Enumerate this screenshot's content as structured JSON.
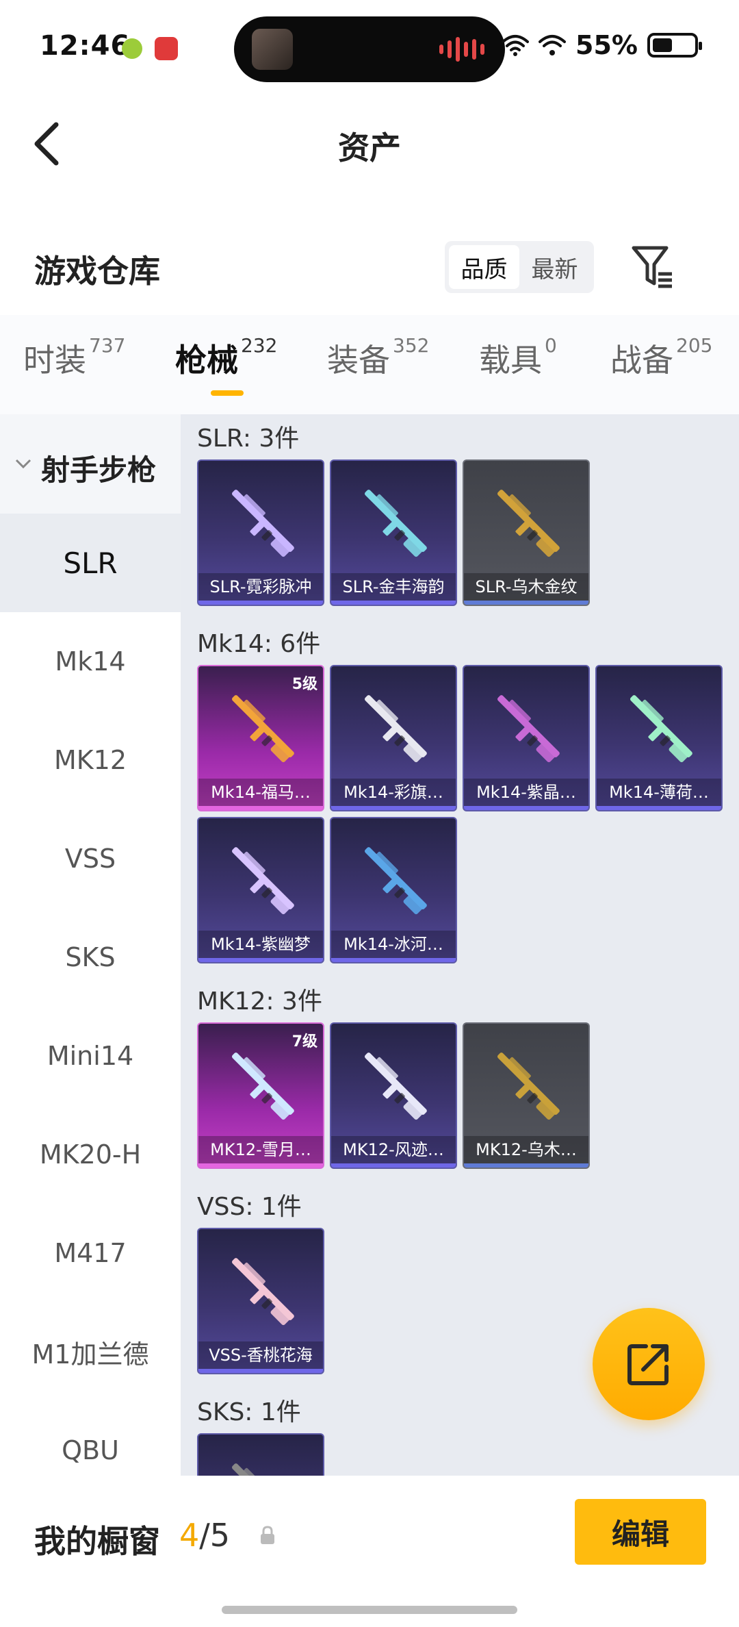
{
  "status_bar": {
    "time": "12:46",
    "battery_percent": "55%",
    "battery_level": 0.55,
    "icons": [
      "app-icon-green",
      "app-icon-red",
      "audio-wave-icon",
      "wifi-icon",
      "signal-icon",
      "battery-icon"
    ]
  },
  "header": {
    "title": "资产",
    "back_icon": "chevron-left-icon"
  },
  "warehouse": {
    "title": "游戏仓库",
    "sort_options": [
      "品质",
      "最新"
    ],
    "selected_sort": "品质",
    "filter_icon": "filter-icon"
  },
  "tabs": [
    {
      "label": "时装",
      "count": "737",
      "active": false
    },
    {
      "label": "枪械",
      "count": "232",
      "active": true
    },
    {
      "label": "装备",
      "count": "352",
      "active": false
    },
    {
      "label": "载具",
      "count": "0",
      "active": false
    },
    {
      "label": "战备",
      "count": "205",
      "active": false
    }
  ],
  "sidebar": {
    "group": "射手步枪",
    "items": [
      "SLR",
      "Mk14",
      "MK12",
      "VSS",
      "SKS",
      "Mini14",
      "MK20-H",
      "M417",
      "M1加兰德",
      "QBU"
    ],
    "selected": "SLR"
  },
  "sections": [
    {
      "title": "SLR: 3件",
      "items": [
        {
          "name": "SLR-霓彩脉冲",
          "tier": "purple",
          "level": ""
        },
        {
          "name": "SLR-金丰海韵",
          "tier": "purple",
          "level": ""
        },
        {
          "name": "SLR-乌木金纹",
          "tier": "gray",
          "level": ""
        }
      ]
    },
    {
      "title": "Mk14: 6件",
      "items": [
        {
          "name": "Mk14-福马…",
          "tier": "pink",
          "level": "5级"
        },
        {
          "name": "Mk14-彩旗…",
          "tier": "purple",
          "level": ""
        },
        {
          "name": "Mk14-紫晶…",
          "tier": "purple",
          "level": ""
        },
        {
          "name": "Mk14-薄荷…",
          "tier": "purple",
          "level": ""
        },
        {
          "name": "Mk14-紫幽梦",
          "tier": "purple",
          "level": ""
        },
        {
          "name": "Mk14-冰河…",
          "tier": "purple",
          "level": ""
        }
      ]
    },
    {
      "title": "MK12: 3件",
      "items": [
        {
          "name": "MK12-雪月…",
          "tier": "pink",
          "level": "7级"
        },
        {
          "name": "MK12-风迹…",
          "tier": "purple",
          "level": ""
        },
        {
          "name": "MK12-乌木…",
          "tier": "gray",
          "level": ""
        }
      ]
    },
    {
      "title": "VSS: 1件",
      "items": [
        {
          "name": "VSS-香桃花海",
          "tier": "purple",
          "level": ""
        }
      ]
    },
    {
      "title": "SKS: 1件",
      "items": [
        {
          "name": "",
          "tier": "purple",
          "level": ""
        }
      ]
    }
  ],
  "fab": {
    "icon": "share-export-icon"
  },
  "bottom_bar": {
    "label": "我的橱窗",
    "count_current": "4",
    "count_total": "5",
    "lock_icon": "lock-icon",
    "edit_label": "编辑"
  },
  "colors": {
    "accent": "#ffbb0e",
    "tier_purple": "#5d5aa8",
    "tier_pink": "#c742c8",
    "tier_gray": "#55575f"
  }
}
